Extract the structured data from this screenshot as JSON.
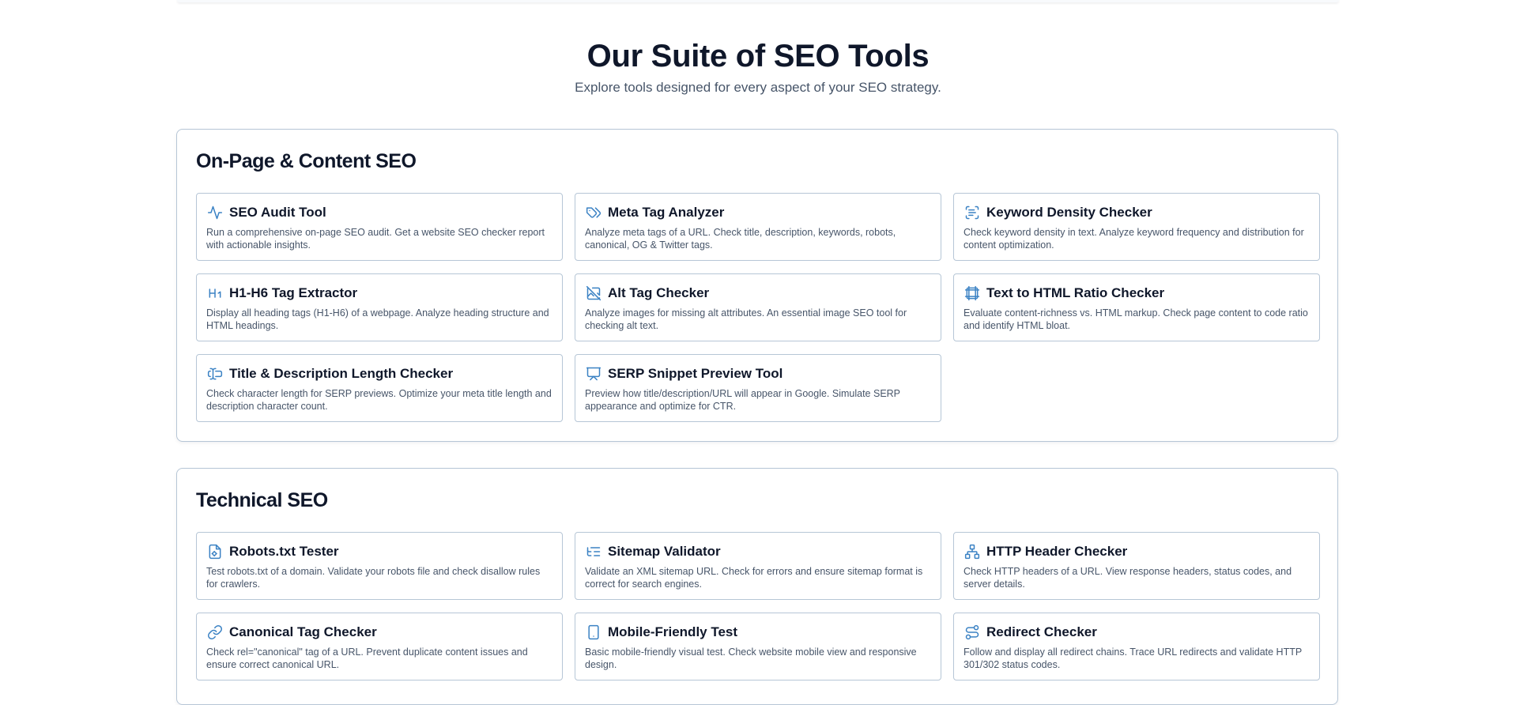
{
  "header": {
    "title": "Our Suite of SEO Tools",
    "subtitle": "Explore tools designed for every aspect of your SEO strategy."
  },
  "colors": {
    "accent": "#3b82c4",
    "border": "#b6c6d6",
    "heading": "#0f172a",
    "muted": "#475569"
  },
  "sections": [
    {
      "title": "On-Page & Content SEO",
      "tools": [
        {
          "icon": "activity-icon",
          "name": "SEO Audit Tool",
          "description": "Run a comprehensive on-page SEO audit. Get a website SEO checker report with actionable insights."
        },
        {
          "icon": "tags-icon",
          "name": "Meta Tag Analyzer",
          "description": "Analyze meta tags of a URL. Check title, description, keywords, robots, canonical, OG & Twitter tags."
        },
        {
          "icon": "scan-text-icon",
          "name": "Keyword Density Checker",
          "description": "Check keyword density in text. Analyze keyword frequency and distribution for content optimization."
        },
        {
          "icon": "heading-1-icon",
          "name": "H1-H6 Tag Extractor",
          "description": "Display all heading tags (H1-H6) of a webpage. Analyze heading structure and HTML headings."
        },
        {
          "icon": "image-off-icon",
          "name": "Alt Tag Checker",
          "description": "Analyze images for missing alt attributes. An essential image SEO tool for checking alt text."
        },
        {
          "icon": "frame-icon",
          "name": "Text to HTML Ratio Checker",
          "description": "Evaluate content-richness vs. HTML markup. Check page content to code ratio and identify HTML bloat."
        },
        {
          "icon": "text-cursor-input-icon",
          "name": "Title & Description Length Checker",
          "description": "Check character length for SERP previews. Optimize your meta title length and description character count."
        },
        {
          "icon": "presentation-icon",
          "name": "SERP Snippet Preview Tool",
          "description": "Preview how title/description/URL will appear in Google. Simulate SERP appearance and optimize for CTR."
        }
      ]
    },
    {
      "title": "Technical SEO",
      "tools": [
        {
          "icon": "file-cog-icon",
          "name": "Robots.txt Tester",
          "description": "Test robots.txt of a domain. Validate your robots file and check disallow rules for crawlers."
        },
        {
          "icon": "list-tree-icon",
          "name": "Sitemap Validator",
          "description": "Validate an XML sitemap URL. Check for errors and ensure sitemap format is correct for search engines."
        },
        {
          "icon": "network-icon",
          "name": "HTTP Header Checker",
          "description": "Check HTTP headers of a URL. View response headers, status codes, and server details."
        },
        {
          "icon": "link-icon",
          "name": "Canonical Tag Checker",
          "description": "Check rel=\"canonical\" tag of a URL. Prevent duplicate content issues and ensure correct canonical URL."
        },
        {
          "icon": "smartphone-icon",
          "name": "Mobile-Friendly Test",
          "description": "Basic mobile-friendly visual test. Check website mobile view and responsive design."
        },
        {
          "icon": "route-icon",
          "name": "Redirect Checker",
          "description": "Follow and display all redirect chains. Trace URL redirects and validate HTTP 301/302 status codes."
        }
      ]
    }
  ]
}
